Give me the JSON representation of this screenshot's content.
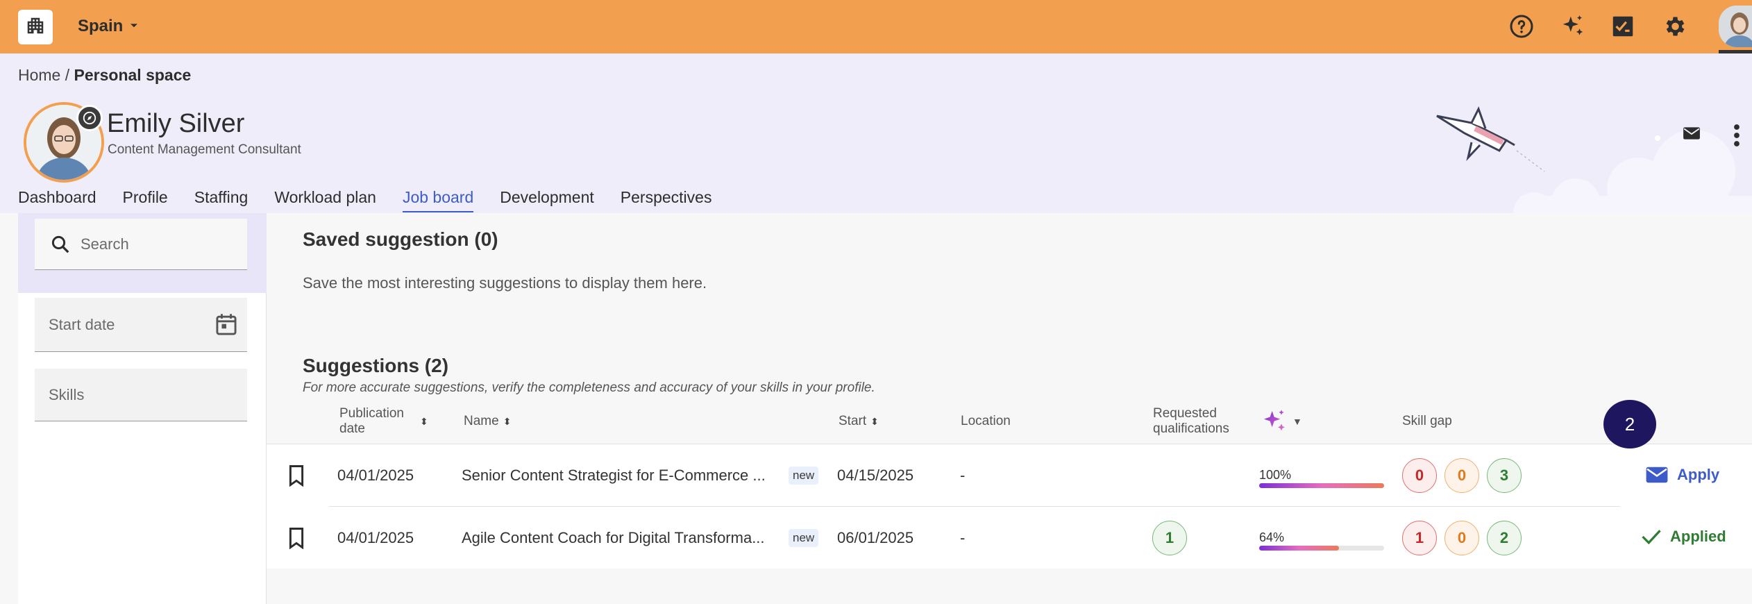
{
  "colors": {
    "topbar": "#f2a050",
    "accent": "#3e5cc9",
    "header_bg": "#efedfa",
    "badge_bg": "#1f1660",
    "applied": "#2e7d32"
  },
  "topbar": {
    "country": "Spain",
    "icons": [
      "help-icon",
      "sparkle-icon",
      "task-check-icon",
      "gear-icon",
      "user-avatar"
    ]
  },
  "breadcrumb": {
    "home": "Home",
    "separator": "/",
    "current": "Personal space"
  },
  "profile": {
    "name": "Emily Silver",
    "title": "Content Management Consultant"
  },
  "tabs": [
    {
      "label": "Dashboard"
    },
    {
      "label": "Profile"
    },
    {
      "label": "Staffing"
    },
    {
      "label": "Workload plan"
    },
    {
      "label": "Job board",
      "active": true
    },
    {
      "label": "Development"
    },
    {
      "label": "Perspectives"
    }
  ],
  "filters": {
    "search_placeholder": "Search",
    "start_date_placeholder": "Start date",
    "skills_placeholder": "Skills"
  },
  "saved": {
    "title": "Saved suggestion (0)",
    "empty_text": "Save the most interesting suggestions to display them here."
  },
  "suggestions": {
    "title": "Suggestions (2)",
    "note": "For more accurate suggestions, verify the completeness and accuracy of your skills in your profile.",
    "columns": {
      "publication_date": "Publication date",
      "name": "Name",
      "start": "Start",
      "location": "Location",
      "requested_qualifications": "Requested qualifications",
      "skill_gap": "Skill gap"
    },
    "badge_count": "2",
    "rows": [
      {
        "publication_date": "04/01/2025",
        "name": "Senior Content Strategist for E-Commerce ...",
        "tag": "new",
        "start": "04/15/2025",
        "location": "-",
        "requested_qualifications": "",
        "match_label": "100%",
        "match_value": 100,
        "gap_red": "0",
        "gap_orange": "0",
        "gap_green": "3",
        "action": "Apply",
        "action_icon": "mail-icon"
      },
      {
        "publication_date": "04/01/2025",
        "name": "Agile Content Coach for Digital Transforma...",
        "tag": "new",
        "start": "06/01/2025",
        "location": "-",
        "requested_qualifications": "1",
        "match_label": "64%",
        "match_value": 64,
        "gap_red": "1",
        "gap_orange": "0",
        "gap_green": "2",
        "action": "Applied",
        "action_icon": "check-icon"
      }
    ]
  }
}
